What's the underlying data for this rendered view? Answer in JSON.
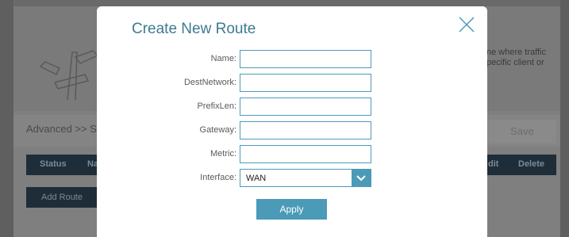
{
  "background": {
    "description_text": "ne where traffic\npecific client or",
    "breadcrumb": "Advanced >> S",
    "save_label": "Save",
    "table_headers": [
      "Status",
      "Na",
      "dit",
      "Delete"
    ],
    "add_route_label": "Add Route"
  },
  "modal": {
    "title": "Create New Route",
    "fields": [
      {
        "label": "Name:",
        "value": ""
      },
      {
        "label": "DestNetwork:",
        "value": ""
      },
      {
        "label": "PrefixLen:",
        "value": ""
      },
      {
        "label": "Gateway:",
        "value": ""
      },
      {
        "label": "Metric:",
        "value": ""
      }
    ],
    "interface": {
      "label": "Interface:",
      "selected": "WAN"
    },
    "apply_label": "Apply"
  },
  "colors": {
    "accent": "#4b9ab7",
    "title": "#3d7a92",
    "table_header": "#1f2d38"
  },
  "icons": {
    "close": "close-icon",
    "dropdown": "chevron-down-icon",
    "signpost": "signpost-icon"
  }
}
